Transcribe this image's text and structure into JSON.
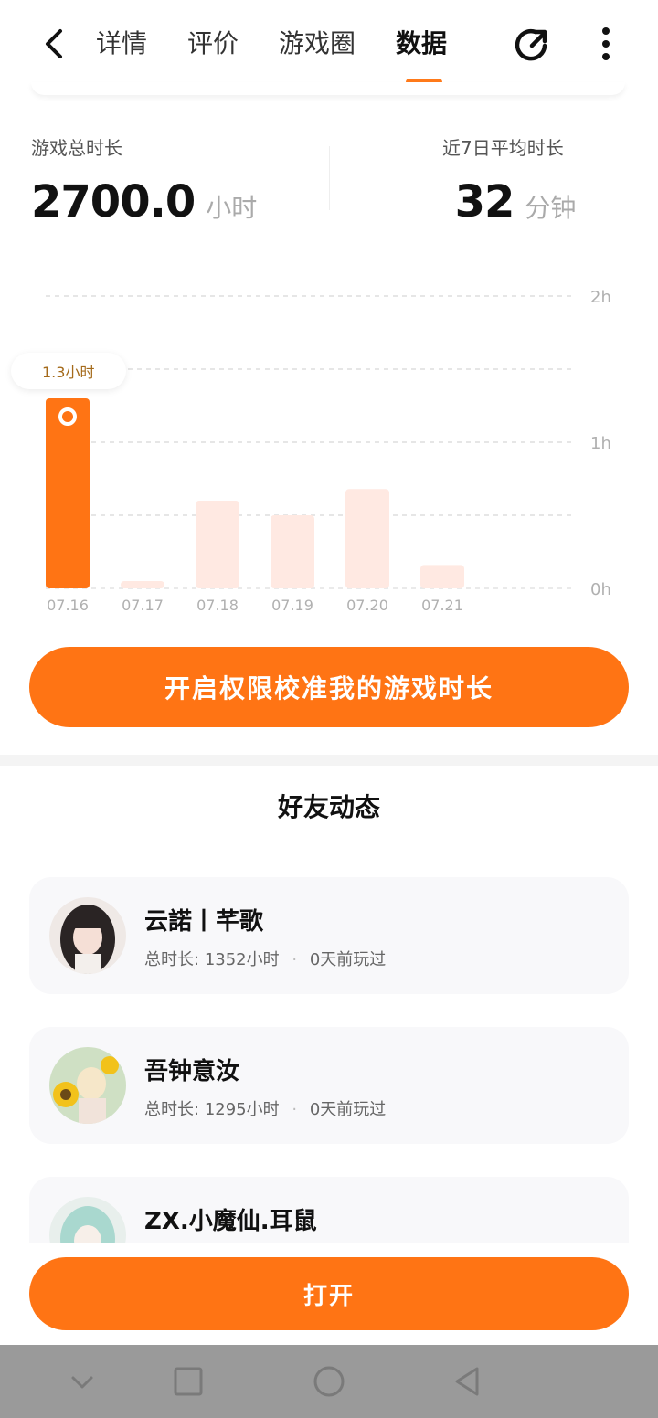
{
  "header": {
    "tabs": [
      {
        "label": "详情",
        "active": false
      },
      {
        "label": "评价",
        "active": false
      },
      {
        "label": "游戏圈",
        "active": false
      },
      {
        "label": "数据",
        "active": true
      }
    ],
    "icons": {
      "back": "back-arrow-icon",
      "share": "share-icon",
      "more": "more-vertical-icon"
    },
    "accent_color": "#ff7a1a"
  },
  "stats": {
    "total": {
      "label": "游戏总时长",
      "value": "2700.0",
      "unit": "小时"
    },
    "avg7": {
      "label": "近7日平均时长",
      "value": "32",
      "unit": "分钟"
    }
  },
  "chart_data": {
    "type": "bar",
    "categories": [
      "07.16",
      "07.17",
      "07.18",
      "07.19",
      "07.20",
      "07.21"
    ],
    "values": [
      1.3,
      0.05,
      0.6,
      0.5,
      0.68,
      0.16
    ],
    "unit": "h",
    "ylim": [
      0,
      2
    ],
    "y_tick_labels": [
      "0h",
      "1h",
      "2h"
    ],
    "grid": true,
    "highlight_index": 0,
    "highlight_label": "1.3小时",
    "colors": {
      "highlight": "#ff7414",
      "normal": "#ffe9e2"
    }
  },
  "calibrate_button": {
    "label": "开启权限校准我的游戏时长"
  },
  "friends": {
    "title": "好友动态",
    "items": [
      {
        "name": "云諾丨芊歌",
        "total_label": "总时长:",
        "total": "1352小时",
        "last_played": "0天前玩过",
        "avatar": "avatar-girl-dark-hair"
      },
      {
        "name": "吾钟意汝",
        "total_label": "总时长:",
        "total": "1295小时",
        "last_played": "0天前玩过",
        "avatar": "avatar-sunflower"
      },
      {
        "name": "ZX.小魔仙.耳鼠",
        "total_label": "",
        "total": "",
        "last_played": "",
        "avatar": "avatar-green-hair"
      }
    ]
  },
  "open_button": {
    "label": "打开"
  },
  "system_nav": {
    "icons": [
      "chevron-down-icon",
      "square-icon",
      "circle-icon",
      "triangle-back-icon"
    ]
  }
}
